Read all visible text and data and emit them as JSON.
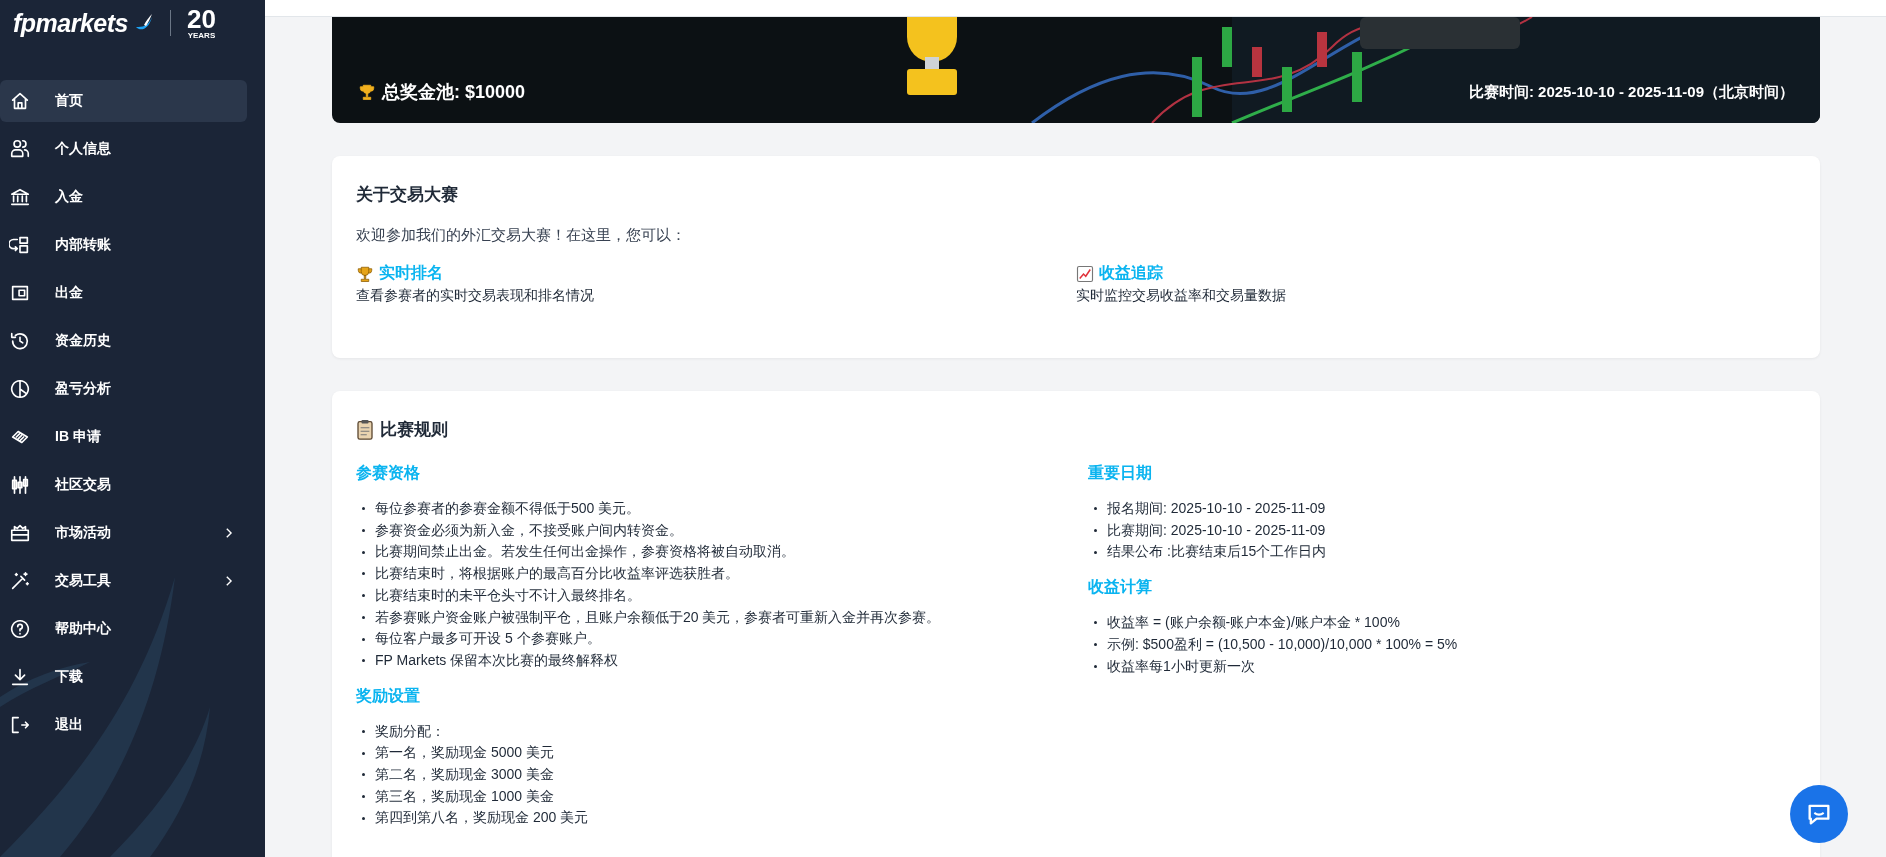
{
  "sidebar": {
    "logo": {
      "brand": "fpmarkets",
      "badge_number": "20",
      "badge_word": "YEARS"
    },
    "items": [
      {
        "label": "首页",
        "selected": true,
        "expandable": false
      },
      {
        "label": "个人信息",
        "selected": false,
        "expandable": false
      },
      {
        "label": "入金",
        "selected": false,
        "expandable": false
      },
      {
        "label": "内部转账",
        "selected": false,
        "expandable": false
      },
      {
        "label": "出金",
        "selected": false,
        "expandable": false
      },
      {
        "label": "资金历史",
        "selected": false,
        "expandable": false
      },
      {
        "label": "盈亏分析",
        "selected": false,
        "expandable": false
      },
      {
        "label": "IB 申请",
        "selected": false,
        "expandable": false
      },
      {
        "label": "社区交易",
        "selected": false,
        "expandable": false
      },
      {
        "label": "市场活动",
        "selected": false,
        "expandable": true
      },
      {
        "label": "交易工具",
        "selected": false,
        "expandable": true
      },
      {
        "label": "帮助中心",
        "selected": false,
        "expandable": false
      },
      {
        "label": "下载",
        "selected": false,
        "expandable": false
      },
      {
        "label": "退出",
        "selected": false,
        "expandable": false
      }
    ]
  },
  "banner": {
    "prize_pool": "总奖金池: $10000",
    "period": "比赛时间: 2025-10-10 - 2025-11-09（北京时间）"
  },
  "about": {
    "title": "关于交易大赛",
    "intro": "欢迎参加我们的外汇交易大赛！在这里，您可以：",
    "features": [
      {
        "title": "实时排名",
        "description": "查看参赛者的实时交易表现和排名情况"
      },
      {
        "title": "收益追踪",
        "description": "实时监控交易收益率和交易量数据"
      }
    ]
  },
  "rules": {
    "title": "比赛规则",
    "columns": [
      [
        {
          "heading": "参赛资格",
          "items": [
            "每位参赛者的参赛金额不得低于500 美元。",
            "参赛资金必须为新入金，不接受账户间内转资金。",
            "比赛期间禁止出金。若发生任何出金操作，参赛资格将被自动取消。",
            "比赛结束时，将根据账户的最高百分比收益率评选获胜者。",
            "比赛结束时的未平仓头寸不计入最终排名。",
            "若参赛账户资金账户被强制平仓，且账户余额低于20 美元，参赛者可重新入金并再次参赛。",
            "每位客户最多可开设 5 个参赛账户。",
            "FP Markets 保留本次比赛的最终解释权"
          ]
        },
        {
          "heading": "奖励设置",
          "items": [
            "奖励分配：",
            "第一名，奖励现金 5000 美元",
            "第二名，奖励现金 3000 美金",
            "第三名，奖励现金 1000 美金",
            "第四到第八名，奖励现金 200 美元"
          ]
        }
      ],
      [
        {
          "heading": "重要日期",
          "items": [
            "报名期间: 2025-10-10 - 2025-11-09",
            "比赛期间: 2025-10-10 - 2025-11-09",
            "结果公布 :比赛结束后15个工作日内"
          ]
        },
        {
          "heading": "收益计算",
          "items": [
            "收益率 = (账户余额-账户本金)/账户本金 * 100%",
            "示例: $500盈利 = (10,500 - 10,000)/10,000 * 100% = 5%",
            "收益率每1小时更新一次"
          ]
        }
      ]
    ]
  }
}
